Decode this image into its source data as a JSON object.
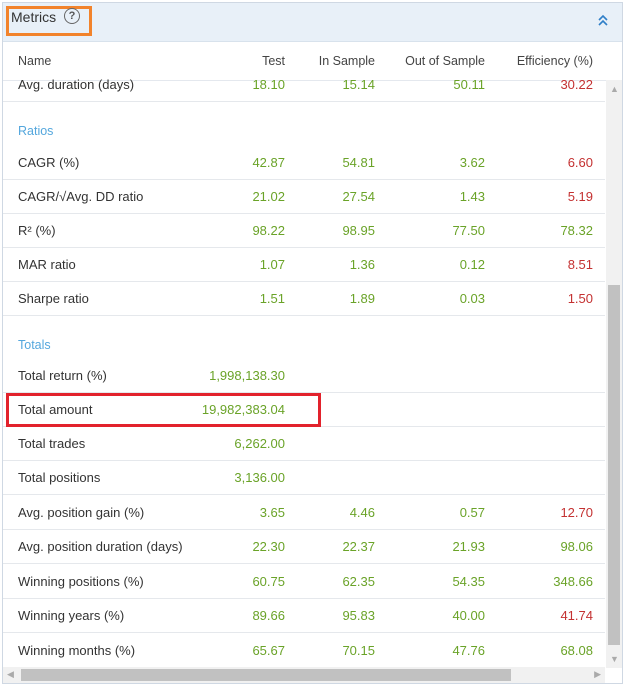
{
  "header": {
    "title": "Metrics",
    "help_icon": "?",
    "collapse_icon": "chevron-double-up"
  },
  "columns": [
    "Name",
    "Test",
    "In Sample",
    "Out of Sample",
    "Efficiency (%)"
  ],
  "colors": {
    "positive": "#6aa328",
    "negative": "#c43131",
    "section": "#54a7dd",
    "highlight": "#e2222c",
    "title_outline": "#f2832b"
  },
  "rows": {
    "avg_duration": {
      "name": "Avg. duration (days)",
      "test": "18.10",
      "in": "15.14",
      "out": "50.11",
      "eff": "30.22"
    },
    "ratios_label": "Ratios",
    "cagr": {
      "name": "CAGR (%)",
      "test": "42.87",
      "in": "54.81",
      "out": "3.62",
      "eff": "6.60"
    },
    "cagr_dd": {
      "name": "CAGR/√Avg. DD ratio",
      "test": "21.02",
      "in": "27.54",
      "out": "1.43",
      "eff": "5.19"
    },
    "r2": {
      "name": "R² (%)",
      "test": "98.22",
      "in": "98.95",
      "out": "77.50",
      "eff": "78.32"
    },
    "mar": {
      "name": "MAR ratio",
      "test": "1.07",
      "in": "1.36",
      "out": "0.12",
      "eff": "8.51"
    },
    "sharpe": {
      "name": "Sharpe ratio",
      "test": "1.51",
      "in": "1.89",
      "out": "0.03",
      "eff": "1.50"
    },
    "totals_label": "Totals",
    "total_return": {
      "name": "Total return (%)",
      "test": "1,998,138.30"
    },
    "total_amount": {
      "name": "Total amount",
      "test": "19,982,383.04"
    },
    "total_trades": {
      "name": "Total trades",
      "test": "6,262.00"
    },
    "total_positions": {
      "name": "Total positions",
      "test": "3,136.00"
    },
    "avg_pos_gain": {
      "name": "Avg. position gain (%)",
      "test": "3.65",
      "in": "4.46",
      "out": "0.57",
      "eff": "12.70"
    },
    "avg_pos_dur": {
      "name": "Avg. position duration (days)",
      "test": "22.30",
      "in": "22.37",
      "out": "21.93",
      "eff": "98.06"
    },
    "win_pos": {
      "name": "Winning positions (%)",
      "test": "60.75",
      "in": "62.35",
      "out": "54.35",
      "eff": "348.66"
    },
    "win_years": {
      "name": "Winning years (%)",
      "test": "89.66",
      "in": "95.83",
      "out": "40.00",
      "eff": "41.74"
    },
    "win_months": {
      "name": "Winning months (%)",
      "test": "65.67",
      "in": "70.15",
      "out": "47.76",
      "eff": "68.08"
    }
  }
}
